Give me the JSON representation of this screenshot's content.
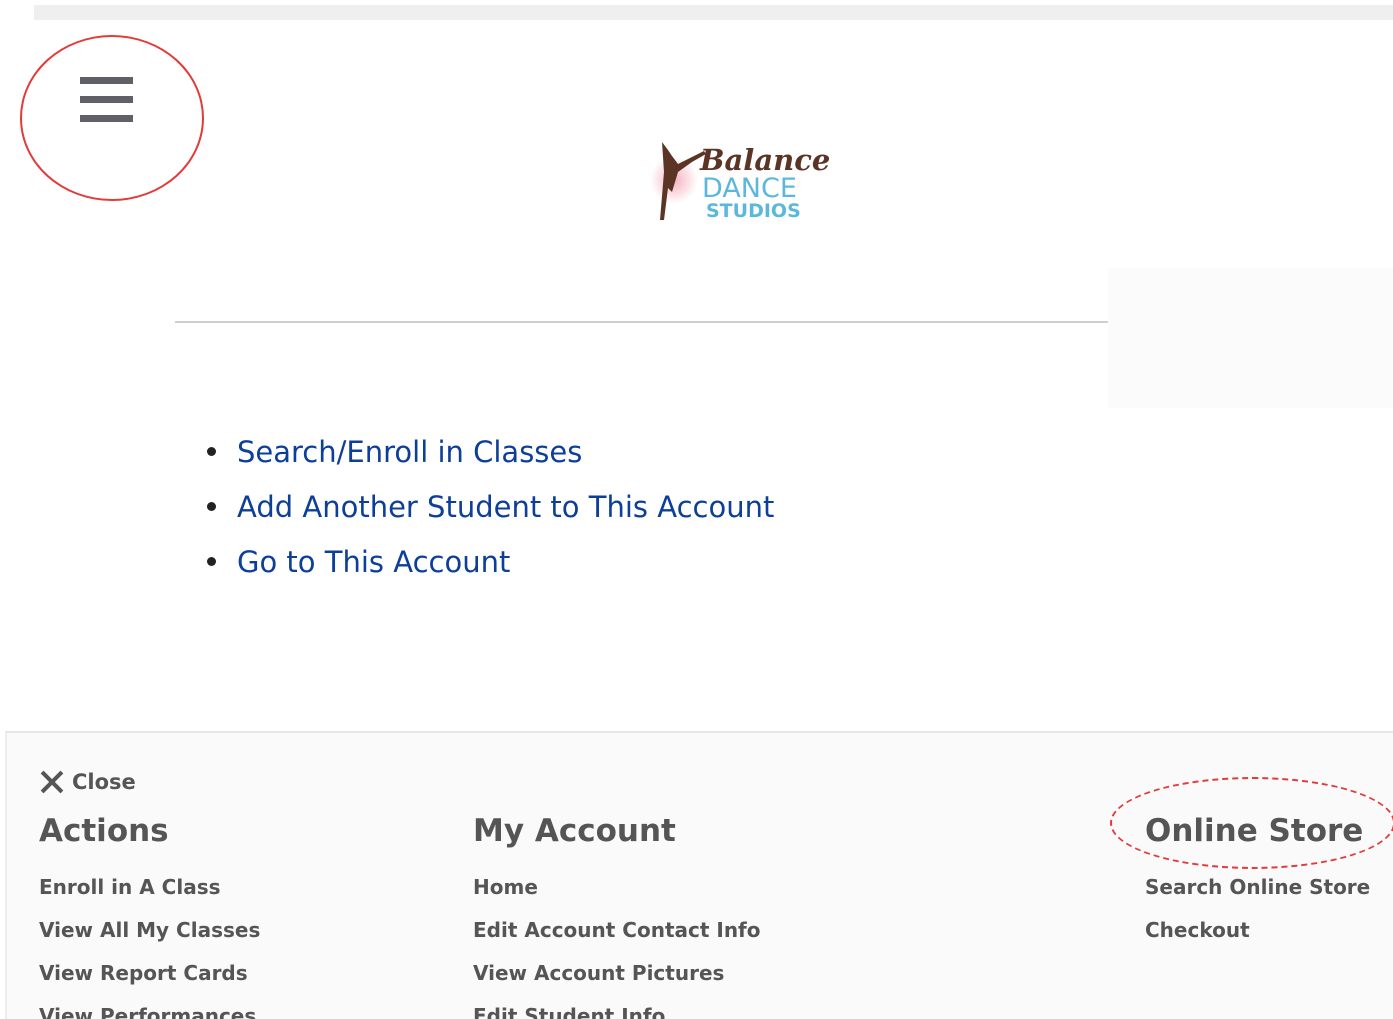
{
  "header": {
    "menu_icon": "hamburger-menu-icon",
    "logo": {
      "line1": "Balance",
      "line2": "DANCE",
      "line3": "STUDIOS"
    }
  },
  "main": {
    "links": [
      {
        "label": "Search/Enroll in Classes"
      },
      {
        "label": "Add Another Student to This Account"
      },
      {
        "label": "Go to This Account"
      }
    ]
  },
  "drawer": {
    "close_label": "Close",
    "close_icon": "close-icon",
    "columns": {
      "actions": {
        "title": "Actions",
        "items": [
          "Enroll in A Class",
          "View All My Classes",
          "View Report Cards",
          "View Performances"
        ]
      },
      "account": {
        "title": "My Account",
        "items": [
          "Home",
          "Edit Account Contact Info",
          "View Account Pictures",
          "Edit Student Info"
        ]
      },
      "store": {
        "title": "Online Store",
        "items": [
          "Search Online Store",
          "Checkout"
        ]
      }
    }
  },
  "colors": {
    "link": "#0d3f99",
    "drawer_text": "#555555",
    "annotation": "#e33a3a",
    "logo_brown": "#5b3426",
    "logo_blue": "#5bb8dc"
  }
}
